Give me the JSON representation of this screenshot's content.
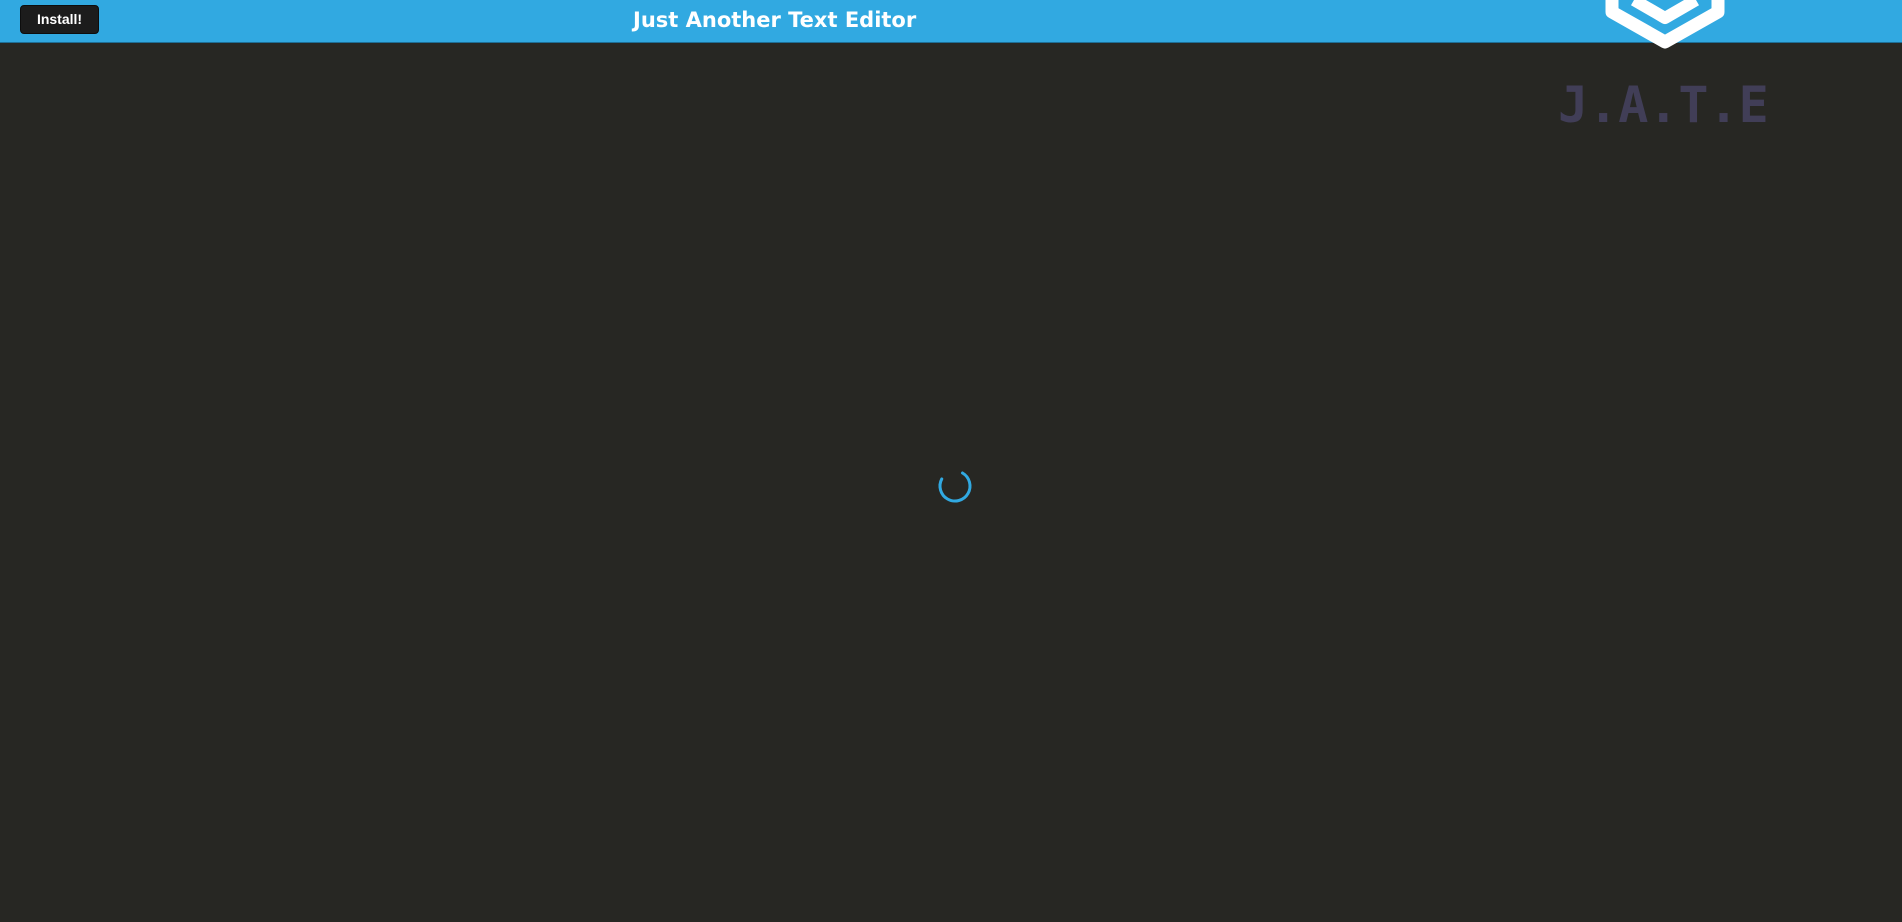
{
  "header": {
    "install_label": "Install!",
    "title": "Just Another Text Editor",
    "background_color": "#31a9e1"
  },
  "logo": {
    "icon": "hexagon-layers-icon",
    "text": "J.A.T.E",
    "text_color": "#413e57"
  },
  "editor": {
    "background_color": "#272723",
    "status": "loading",
    "spinner_icon": "loading-spinner-icon",
    "spinner_color": "#31a9e1"
  }
}
